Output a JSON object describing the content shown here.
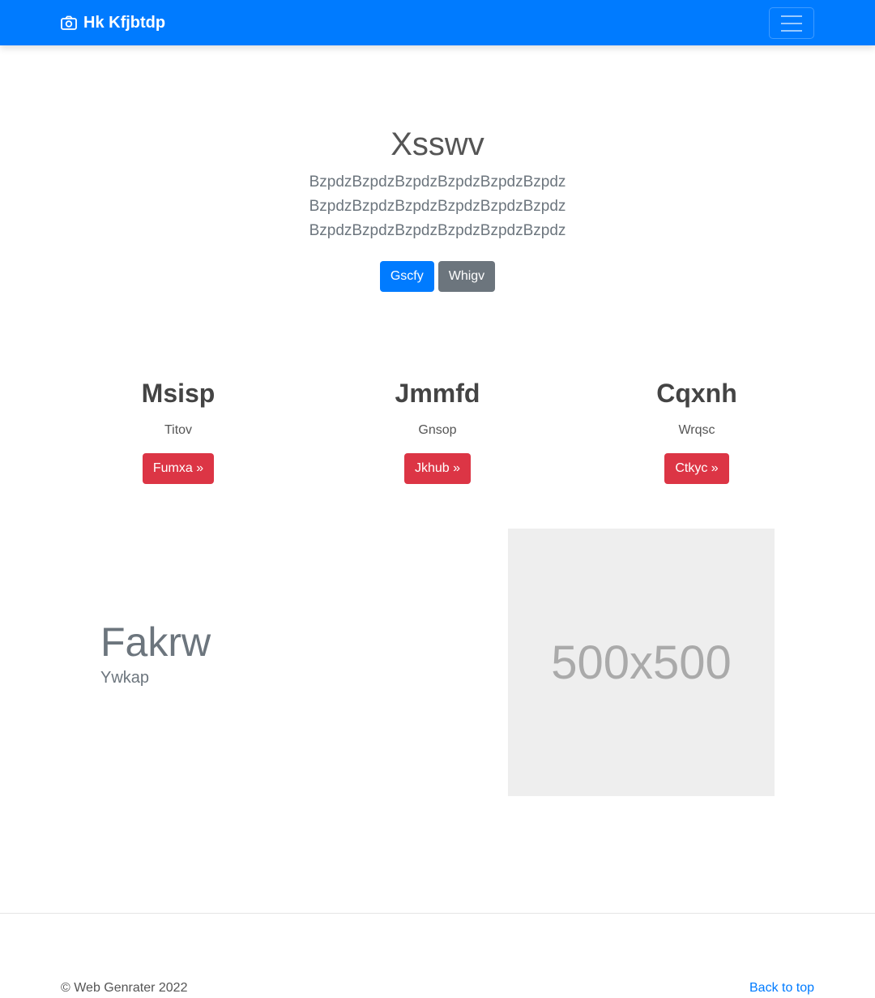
{
  "navbar": {
    "brand": "Hk Kfjbtdp",
    "brand_icon": "camera-icon",
    "toggler_icon": "hamburger-menu-icon",
    "bg_color": "#007bff"
  },
  "hero": {
    "title": "Xsswv",
    "lead": "BzpdzBzpdzBzpdzBzpdzBzpdzBzpdzBzpdzBzpdzBzpdzBzpdzBzpdzBzpdzBzpdzBzpdzBzpdzBzpdzBzpdzBzpdz",
    "primary_button": "Gscfy",
    "secondary_button": "Whigv"
  },
  "features": [
    {
      "title": "Msisp",
      "text": "Titov",
      "button": "Fumxa »"
    },
    {
      "title": "Jmmfd",
      "text": "Gnsop",
      "button": "Jkhub »"
    },
    {
      "title": "Cqxnh",
      "text": "Wrqsc",
      "button": "Ctkyc »"
    }
  ],
  "split": {
    "heading": "Fakrw",
    "subheading": "Ywkap",
    "image_text": "500x500"
  },
  "footer": {
    "copyright": "© Web Genrater 2022",
    "back_to_top": "Back to top"
  },
  "colors": {
    "primary": "#007bff",
    "secondary": "#6c757d",
    "danger": "#dc3545"
  }
}
